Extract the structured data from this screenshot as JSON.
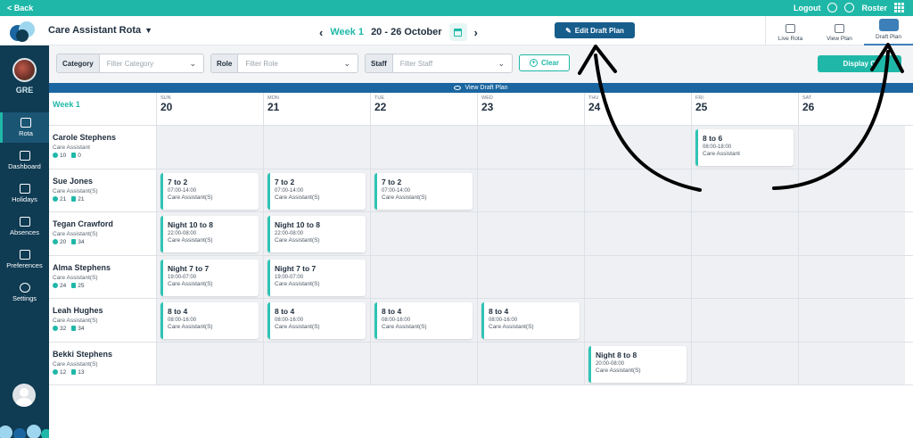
{
  "topbar": {
    "back_label": "Back",
    "logout_label": "Logout",
    "roster_label": "Roster"
  },
  "header": {
    "app_title": "Care Assistant Rota",
    "week_label": "Week 1",
    "date_range": "20 - 26 October",
    "edit_label": "Edit Draft Plan",
    "view_tabs": [
      {
        "label": "Live Rota",
        "icon": "clipboard-icon"
      },
      {
        "label": "View Plan",
        "icon": "briefcase-icon"
      },
      {
        "label": "Draft Plan",
        "icon": "pencil-icon",
        "active": true
      }
    ]
  },
  "sidebar": {
    "site_code": "GRE",
    "items": [
      {
        "label": "Rota",
        "icon": "calendar-icon",
        "active": true
      },
      {
        "label": "Dashboard",
        "icon": "dashboard-icon"
      },
      {
        "label": "Holidays",
        "icon": "beach-icon"
      },
      {
        "label": "Absences",
        "icon": "people-icon"
      },
      {
        "label": "Preferences",
        "icon": "user-settings-icon"
      },
      {
        "label": "Settings",
        "icon": "gear-icon"
      }
    ]
  },
  "filters": {
    "category": {
      "label": "Category",
      "placeholder": "Filter Category"
    },
    "role": {
      "label": "Role",
      "placeholder": "Filter Role"
    },
    "staff": {
      "label": "Staff",
      "placeholder": "Filter Staff"
    },
    "clear_label": "Clear",
    "display_label": "Display O"
  },
  "banner_label": "View Draft Plan",
  "grid": {
    "week_label": "Week 1",
    "days": [
      {
        "name": "SUN",
        "date": "20"
      },
      {
        "name": "MON",
        "date": "21"
      },
      {
        "name": "TUE",
        "date": "22"
      },
      {
        "name": "WED",
        "date": "23"
      },
      {
        "name": "THU",
        "date": "24"
      },
      {
        "name": "FRI",
        "date": "25"
      },
      {
        "name": "SAT",
        "date": "26"
      }
    ],
    "rows": [
      {
        "name": "Carole Stephens",
        "role": "Care Assistant",
        "stat1": "10",
        "stat2": "0",
        "shifts": [
          null,
          null,
          null,
          null,
          null,
          {
            "name": "8 to 6",
            "time": "08:00-18:00",
            "role": "Care Assistant"
          },
          null
        ]
      },
      {
        "name": "Sue Jones",
        "role": "Care Assistant(S)",
        "stat1": "21",
        "stat2": "21",
        "shifts": [
          {
            "name": "7 to 2",
            "time": "07:00-14:00",
            "role": "Care Assistant(S)"
          },
          {
            "name": "7 to 2",
            "time": "07:00-14:00",
            "role": "Care Assistant(S)"
          },
          {
            "name": "7 to 2",
            "time": "07:00-14:00",
            "role": "Care Assistant(S)"
          },
          null,
          null,
          null,
          null
        ]
      },
      {
        "name": "Tegan Crawford",
        "role": "Care Assistant(S)",
        "stat1": "20",
        "stat2": "34",
        "shifts": [
          {
            "name": "Night 10 to 8",
            "time": "22:00-08:00",
            "role": "Care Assistant(S)"
          },
          {
            "name": "Night 10 to 8",
            "time": "22:00-08:00",
            "role": "Care Assistant(S)"
          },
          null,
          null,
          null,
          null,
          null
        ]
      },
      {
        "name": "Alma Stephens",
        "role": "Care Assistant(S)",
        "stat1": "24",
        "stat2": "25",
        "shifts": [
          {
            "name": "Night 7 to 7",
            "time": "19:00-07:00",
            "role": "Care Assistant(S)"
          },
          {
            "name": "Night 7 to 7",
            "time": "19:00-07:00",
            "role": "Care Assistant(S)"
          },
          null,
          null,
          null,
          null,
          null
        ]
      },
      {
        "name": "Leah Hughes",
        "role": "Care Assistant(S)",
        "stat1": "32",
        "stat2": "34",
        "shifts": [
          {
            "name": "8 to 4",
            "time": "08:00-16:00",
            "role": "Care Assistant(S)"
          },
          {
            "name": "8 to 4",
            "time": "08:00-16:00",
            "role": "Care Assistant(S)"
          },
          {
            "name": "8 to 4",
            "time": "08:00-16:00",
            "role": "Care Assistant(S)"
          },
          {
            "name": "8 to 4",
            "time": "08:00-16:00",
            "role": "Care Assistant(S)"
          },
          null,
          null,
          null
        ]
      },
      {
        "name": "Bekki Stephens",
        "role": "Care Assistant(S)",
        "stat1": "12",
        "stat2": "13",
        "shifts": [
          null,
          null,
          null,
          null,
          {
            "name": "Night 8 to 8",
            "time": "20:00-08:00",
            "role": "Care Assistant(S)"
          },
          null,
          null
        ]
      }
    ]
  },
  "colors": {
    "teal": "#1fb8a8",
    "navy": "#0f3b53",
    "edit_blue": "#175d8c",
    "banner_blue": "#1b66a0"
  }
}
